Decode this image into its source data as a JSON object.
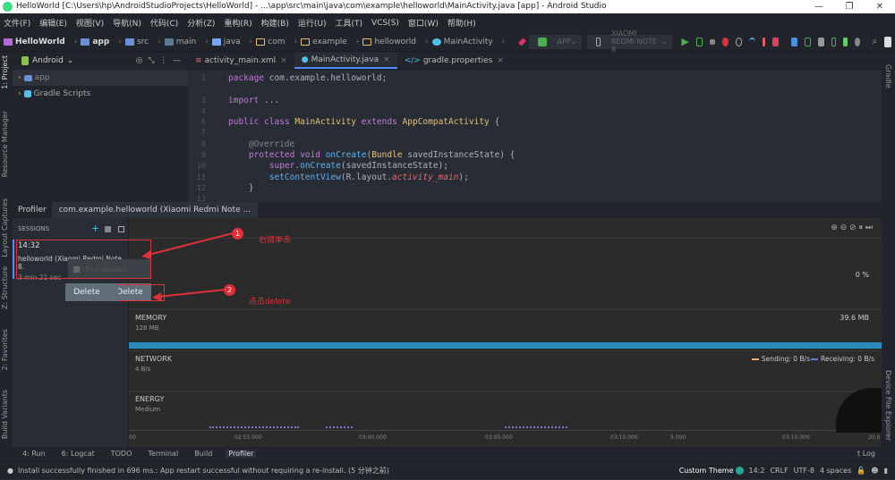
{
  "window": {
    "title": "HelloWorld [C:\\Users\\hp\\AndroidStudioProjects\\HelloWorld] - ...\\app\\src\\main\\java\\com\\example\\helloworld\\MainActivity.java [app] - Android Studio",
    "controls": [
      "—",
      "❐",
      "✕"
    ]
  },
  "menu": [
    "文件(F)",
    "编辑(E)",
    "视图(V)",
    "导航(N)",
    "代码(C)",
    "分析(Z)",
    "重构(R)",
    "构建(B)",
    "运行(U)",
    "工具(T)",
    "VCS(S)",
    "窗口(W)",
    "帮助(H)"
  ],
  "breadcrumb": [
    "HelloWorld",
    "app",
    "src",
    "main",
    "java",
    "com",
    "example",
    "helloworld",
    "MainActivity"
  ],
  "toolbar": {
    "config": "APP",
    "device": "XIAOMI REDMI NOTE 8"
  },
  "project": {
    "view": "Android",
    "items": [
      "app",
      "Gradle Scripts"
    ]
  },
  "editor": {
    "tabs": [
      "activity_main.xml",
      "MainActivity.java",
      "gradle.properties"
    ],
    "active_tab": 1,
    "line_numbers": [
      "1",
      "3",
      "6",
      "7",
      "8",
      "9",
      "10",
      "11",
      "12",
      "13"
    ]
  },
  "left_strip": [
    "1: Project",
    "Resource Manager",
    "Layout Captures",
    "Z: Structure",
    "2: Favorites",
    "Build Variants"
  ],
  "right_strip": [
    "Gradle",
    "Device File Explorer"
  ],
  "profiler": {
    "tab": "Profiler",
    "session_tab": "com.example.helloworld (Xiaomi Redmi Note ...",
    "sessions_label": "SESSIONS",
    "session": {
      "time": "14:32",
      "name": "helloworld (Xiaomi Redmi Note 8.",
      "duration": "3 min 21 sec"
    },
    "context_menu": {
      "end_session": "End session",
      "delete": "Delete",
      "delete_highlighted": "Delete"
    },
    "cpu_value": "0 %",
    "memory": {
      "label": "MEMORY",
      "scale": "128 MB",
      "value": "39.6 MB"
    },
    "network": {
      "label": "NETWORK",
      "scale": "4 B/s",
      "sending": "Sending: 0 B/s",
      "receiving": "Receiving: 0 B/s"
    },
    "energy": {
      "label": "ENERGY",
      "scale": "Medium"
    },
    "time_ticks": [
      "00",
      "02:55.000",
      "03:00.000",
      "03:05.000",
      "03:10.000",
      "5.000",
      "03:10.000",
      "20.0"
    ]
  },
  "annotations": {
    "step1": "1",
    "step1_text": "右键单击",
    "step2": "2",
    "step2_text": "点击delete"
  },
  "bottom_tabs": [
    "4: Run",
    "6: Logcat",
    "TODO",
    "Terminal",
    "Build",
    "Profiler"
  ],
  "event_log": "t Log",
  "status": {
    "message": "Install successfully finished in 696 ms.: App restart successful without requiring a re-install. (5 分钟之前)",
    "theme": "Custom Theme",
    "position": "14:2",
    "line_sep": "CRLF",
    "encoding": "UTF-8",
    "indent": "4 spaces"
  },
  "colors": {
    "accent": "#528bff",
    "memory_bar": "#2a8cb8",
    "annotation": "#e0303a",
    "run": "#4caf50"
  }
}
